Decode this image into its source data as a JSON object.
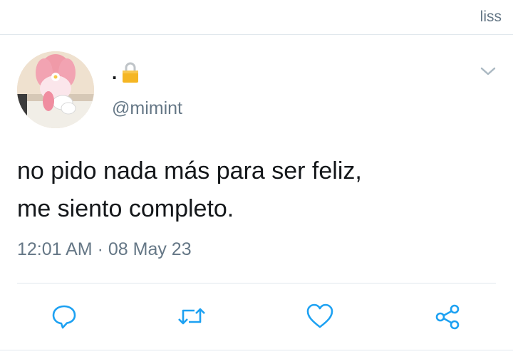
{
  "topbar": {
    "user_label": "liss"
  },
  "tweet": {
    "display_name": ".",
    "handle": "@mimint",
    "text_line1": "no pido nada más para ser feliz,",
    "text_line2": "me siento completo.",
    "time": "12:01 AM",
    "separator": "·",
    "date": "08 May 23"
  },
  "icons": {
    "lock": "lock-icon",
    "chevron": "chevron-down-icon",
    "reply": "reply-icon",
    "retweet": "retweet-icon",
    "like": "heart-icon",
    "share": "share-icon"
  },
  "colors": {
    "text": "#14171a",
    "secondary": "#657786",
    "action_icon": "#1da1f2",
    "divider": "#e1e8ed"
  }
}
